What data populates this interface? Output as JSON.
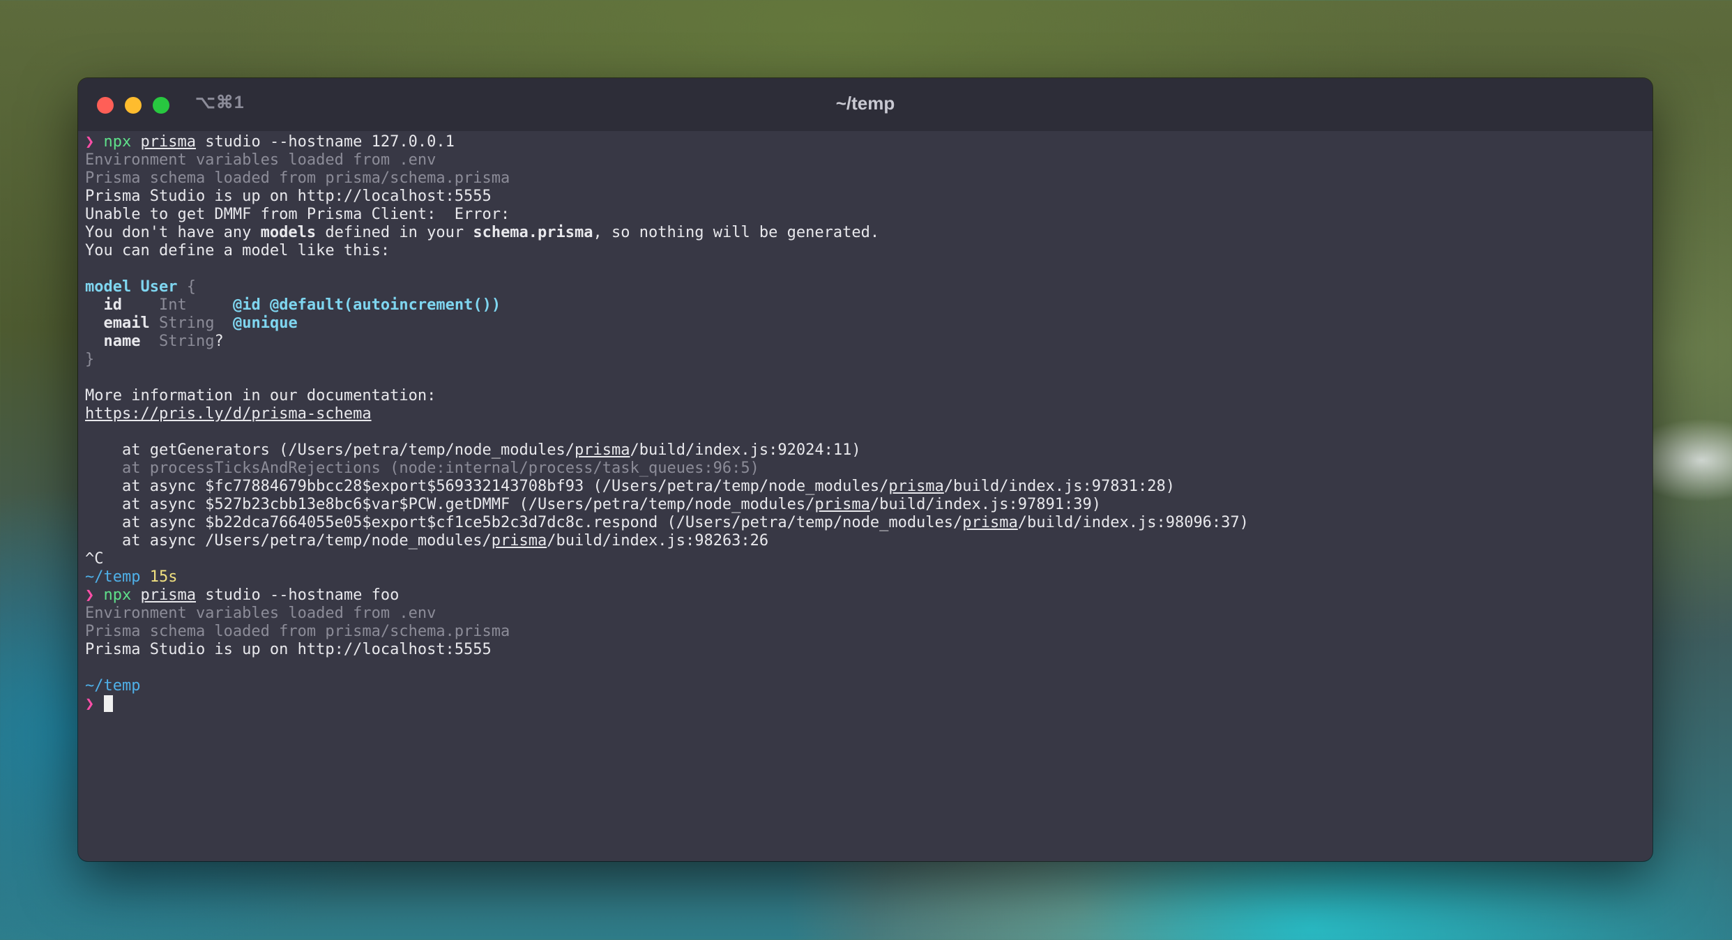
{
  "window": {
    "shortcut": "⌥⌘1",
    "title": "~/temp"
  },
  "terminal": {
    "prompt_symbol": "❯",
    "cmd1": {
      "npx": "npx",
      "prisma": "prisma",
      "rest": " studio --hostname 127.0.0.1"
    },
    "env_loaded": "Environment variables loaded from .env",
    "schema_loaded": "Prisma schema loaded from prisma/schema.prisma",
    "studio_up": "Prisma Studio is up on http://localhost:5555",
    "dmmf_error": "Unable to get DMMF from Prisma Client:  Error:",
    "no_models": {
      "pre": "You don't have any ",
      "models": "models",
      "mid": " defined in your ",
      "schema": "schema.prisma",
      "post": ", so nothing will be generated."
    },
    "define_hint": "You can define a model like this:",
    "model": {
      "keyword": "model",
      "name": "User",
      "open_brace": "{",
      "close_brace": "}",
      "fields": [
        {
          "name": "id",
          "type": "Int",
          "attrs": "@id @default(autoincrement())"
        },
        {
          "name": "email",
          "type": "String",
          "attrs": "@unique"
        },
        {
          "name": "name",
          "type": "String",
          "suffix": "?"
        }
      ]
    },
    "more_info": "More information in our documentation:",
    "doc_link": "https://pris.ly/d/prisma-schema",
    "stack": [
      {
        "pre": "    at getGenerators (/Users/petra/temp/node_modules/",
        "u": "prisma",
        "post": "/build/index.js:92024:11)"
      },
      {
        "text": "    at processTicksAndRejections (node:internal/process/task_queues:96:5)"
      },
      {
        "pre": "    at async $fc77884679bbcc28$export$569332143708bf93 (/Users/petra/temp/node_modules/",
        "u": "prisma",
        "post": "/build/index.js:97831:28)"
      },
      {
        "pre": "    at async $527b23cbb13e8bc6$var$PCW.getDMMF (/Users/petra/temp/node_modules/",
        "u": "prisma",
        "post": "/build/index.js:97891:39)"
      },
      {
        "pre": "    at async $b22dca7664055e05$export$cf1ce5b2c3d7dc8c.respond (/Users/petra/temp/node_modules/",
        "u": "prisma",
        "post": "/build/index.js:98096:37)"
      },
      {
        "pre": "    at async /Users/petra/temp/node_modules/",
        "u": "prisma",
        "post": "/build/index.js:98263:26"
      }
    ],
    "ctrl_c": "^C",
    "prompt_dir1": "~/temp",
    "prompt_duration": "15s",
    "cmd2": {
      "npx": "npx",
      "prisma": "prisma",
      "rest": " studio --hostname foo"
    },
    "prompt_dir2": "~/temp"
  }
}
